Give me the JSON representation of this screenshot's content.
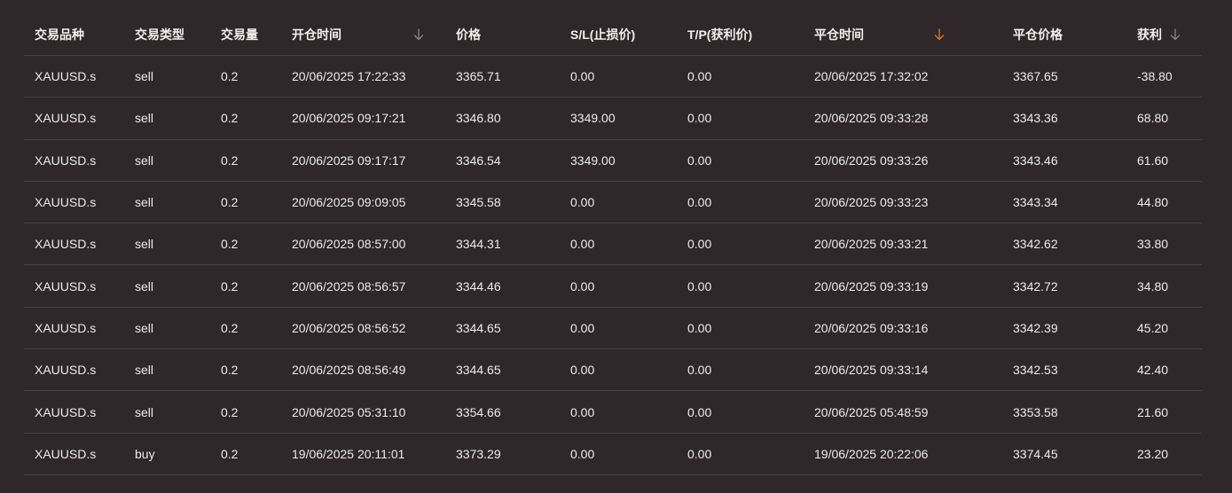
{
  "columns": {
    "symbol": "交易品种",
    "type": "交易类型",
    "volume": "交易量",
    "open_time": "开仓时间",
    "price": "价格",
    "sl": "S/L(止损价)",
    "tp": "T/P(获利价)",
    "close_time": "平仓时间",
    "close_price": "平仓价格",
    "profit": "获利"
  },
  "icons": {
    "open_time_sort": "arrow-down-icon",
    "close_time_sort": "arrow-down-icon",
    "profit_sort": "arrow-down-icon"
  },
  "colors": {
    "background": "#30272a",
    "sort_inactive": "#8c8488",
    "sort_active": "#e8731f",
    "row_divider": "#4a4044"
  },
  "rows": [
    {
      "symbol": "XAUUSD.s",
      "type": "sell",
      "volume": "0.2",
      "open_time": "20/06/2025 17:22:33",
      "price": "3365.71",
      "sl": "0.00",
      "tp": "0.00",
      "close_time": "20/06/2025 17:32:02",
      "close_price": "3367.65",
      "profit": "-38.80"
    },
    {
      "symbol": "XAUUSD.s",
      "type": "sell",
      "volume": "0.2",
      "open_time": "20/06/2025 09:17:21",
      "price": "3346.80",
      "sl": "3349.00",
      "tp": "0.00",
      "close_time": "20/06/2025 09:33:28",
      "close_price": "3343.36",
      "profit": "68.80"
    },
    {
      "symbol": "XAUUSD.s",
      "type": "sell",
      "volume": "0.2",
      "open_time": "20/06/2025 09:17:17",
      "price": "3346.54",
      "sl": "3349.00",
      "tp": "0.00",
      "close_time": "20/06/2025 09:33:26",
      "close_price": "3343.46",
      "profit": "61.60"
    },
    {
      "symbol": "XAUUSD.s",
      "type": "sell",
      "volume": "0.2",
      "open_time": "20/06/2025 09:09:05",
      "price": "3345.58",
      "sl": "0.00",
      "tp": "0.00",
      "close_time": "20/06/2025 09:33:23",
      "close_price": "3343.34",
      "profit": "44.80"
    },
    {
      "symbol": "XAUUSD.s",
      "type": "sell",
      "volume": "0.2",
      "open_time": "20/06/2025 08:57:00",
      "price": "3344.31",
      "sl": "0.00",
      "tp": "0.00",
      "close_time": "20/06/2025 09:33:21",
      "close_price": "3342.62",
      "profit": "33.80"
    },
    {
      "symbol": "XAUUSD.s",
      "type": "sell",
      "volume": "0.2",
      "open_time": "20/06/2025 08:56:57",
      "price": "3344.46",
      "sl": "0.00",
      "tp": "0.00",
      "close_time": "20/06/2025 09:33:19",
      "close_price": "3342.72",
      "profit": "34.80"
    },
    {
      "symbol": "XAUUSD.s",
      "type": "sell",
      "volume": "0.2",
      "open_time": "20/06/2025 08:56:52",
      "price": "3344.65",
      "sl": "0.00",
      "tp": "0.00",
      "close_time": "20/06/2025 09:33:16",
      "close_price": "3342.39",
      "profit": "45.20"
    },
    {
      "symbol": "XAUUSD.s",
      "type": "sell",
      "volume": "0.2",
      "open_time": "20/06/2025 08:56:49",
      "price": "3344.65",
      "sl": "0.00",
      "tp": "0.00",
      "close_time": "20/06/2025 09:33:14",
      "close_price": "3342.53",
      "profit": "42.40"
    },
    {
      "symbol": "XAUUSD.s",
      "type": "sell",
      "volume": "0.2",
      "open_time": "20/06/2025 05:31:10",
      "price": "3354.66",
      "sl": "0.00",
      "tp": "0.00",
      "close_time": "20/06/2025 05:48:59",
      "close_price": "3353.58",
      "profit": "21.60"
    },
    {
      "symbol": "XAUUSD.s",
      "type": "buy",
      "volume": "0.2",
      "open_time": "19/06/2025 20:11:01",
      "price": "3373.29",
      "sl": "0.00",
      "tp": "0.00",
      "close_time": "19/06/2025 20:22:06",
      "close_price": "3374.45",
      "profit": "23.20"
    }
  ]
}
